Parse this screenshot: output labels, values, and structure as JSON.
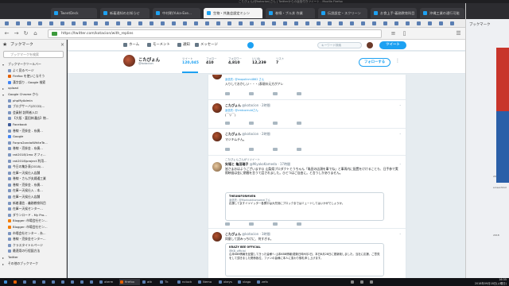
{
  "window": {
    "title": "こたぴょん(@kotacion)さん | Twitterからの返信付きツイート - Mozilla Firefox"
  },
  "tabs": [
    {
      "label": "TweetDeck"
    },
    {
      "label": "新着通知のお知らせ"
    },
    {
      "label": "中村朝(Yuka-Exe..."
    },
    {
      "label": "生物・共進会設定ミシン"
    },
    {
      "label": "巻線・ブル丼 作業"
    },
    {
      "label": "伝説設定・スクリーン"
    },
    {
      "label": "お食上手-義務教育科目"
    },
    {
      "label": "沖縄工業の通行可能"
    }
  ],
  "browser": {
    "url": "https://twitter.com/kotacion/with_replies"
  },
  "sidebar": {
    "title": "ブックマーク",
    "search_placeholder": "ブックマークを検索",
    "items": [
      {
        "label": "ブックマークツールバー",
        "level": 0
      },
      {
        "label": "よく見るページ",
        "level": 1
      },
      {
        "label": "Firefox を使いこなそう",
        "level": 1
      },
      {
        "label": "漢字誤り - Google 検索",
        "level": 1
      },
      {
        "label": "upload",
        "level": 0
      },
      {
        "label": "Google Chrome から",
        "level": 0
      },
      {
        "label": "phpMyAdmin",
        "level": 1
      },
      {
        "label": "ブログサーバ(ZCCD)...",
        "level": 1
      },
      {
        "label": "会員制 訪問者入口",
        "level": 1
      },
      {
        "label": "【大阪・富田林通店】物...",
        "level": 1
      },
      {
        "label": "Facebook",
        "level": 1
      },
      {
        "label": "巻線・売掛金 - 糸廣...",
        "level": 1
      },
      {
        "label": "Google",
        "level": 1
      },
      {
        "label": "Forpro2ondaiWhiteTe...",
        "level": 1
      },
      {
        "label": "巻線・売掛金 - 糸廣...",
        "level": 1
      },
      {
        "label": "rak2018/1mo オフィ...",
        "level": 1
      },
      {
        "label": "rak2018/project 利用...",
        "level": 1
      },
      {
        "label": "今日の集計表(2018/...",
        "level": 1
      },
      {
        "label": "在庫ー天候仕入店舗",
        "level": 1
      },
      {
        "label": "巻線・さんが夫婦通工業",
        "level": 1
      },
      {
        "label": "巻線・売掛金 - 糸廣...",
        "level": 1
      },
      {
        "label": "在庫ー天候仕入 - 本...",
        "level": 1
      },
      {
        "label": "在庫ー天候仕入店舗",
        "level": 1
      },
      {
        "label": "新着通信 - 義務教育科目",
        "level": 1
      },
      {
        "label": "在庫ー天候センター...",
        "level": 1
      },
      {
        "label": "ダウンロード - My Pro...",
        "level": 1
      },
      {
        "label": "Blogger: 市場会社セン...",
        "level": 1
      },
      {
        "label": "Blogger: 市場会社セン...",
        "level": 1
      },
      {
        "label": "市場会社センター - 糸...",
        "level": 1
      },
      {
        "label": "巻線・売掛金センター...",
        "level": 1
      },
      {
        "label": "クラスタイトルページ",
        "level": 1
      },
      {
        "label": "最適用の行程図方法",
        "level": 1
      },
      {
        "label": "Twitter",
        "level": 0
      },
      {
        "label": "その他のブックマーク",
        "level": 0
      }
    ]
  },
  "twitter_nav": {
    "home": "ホーム",
    "moments": "モーメント",
    "notifications": "通知",
    "messages": "メッセージ",
    "search_placeholder": "キーワード検索",
    "tweet_button": "ツイート"
  },
  "profile": {
    "name": "こたぴょん",
    "handle": "@kotacion",
    "stats": [
      {
        "label": "ツイート",
        "value": "120,045"
      },
      {
        "label": "フォロー",
        "value": "410"
      },
      {
        "label": "フォロワー",
        "value": "4,810"
      },
      {
        "label": "いいね",
        "value": "12,239"
      },
      {
        "label": "リスト",
        "value": "7"
      }
    ],
    "follow_button": "フォローする"
  },
  "tweets": [
    {
      "reply_to": "返信先: @mopolinm4862 さん",
      "text": "入りしておかしい・・・(表現の元方がアレ"
    },
    {
      "name": "こたぴょん",
      "handle": "@kotacion · 2時間",
      "reply_to": "返信先: @cmtcoreuldさん",
      "text": "(￣▽￣)"
    },
    {
      "name": "こたぴょん",
      "handle": "@kotacion · 2時間",
      "text": "マジキムチん。"
    },
    {
      "retweet_note": "こたぴょんさんがリツイート",
      "name": "矢場と 亀田瑞子",
      "handle": "@MiyakoKameda · 17時間",
      "text": "皆さまおはようございます☺ 山梨県プロダクトとうちゃん「亀田の店頭を事でね」と事再内に配置をけけることも、日手参で実際映画は金に期間を言うて話されました。ひとつはご自由に。と言うしかありません。",
      "card_title": "THEUNIFORMVEN",
      "card_sub": "返信先: @MorinakKamameiさん",
      "card_text": "応援してますイツイッター各関中は大先刻にブロックまではミュートしてはいかがでしょうか。"
    },
    {
      "name": "こたぴょん",
      "handle": "@kotacion · 3時間",
      "text": "同意して読みっちけに、何すぎる。",
      "card_title": "KRAZY BEE OFFICIAL",
      "card_sub": "@KB_official",
      "card_text": "山本KBB情報を記載してきった皆様へ 山本KBB情報(更新日時9月2日、本日8月28日に更新致しました。当社に応援、ご意見をして頂きました関係各位、ファンの皆様に本人に変わり御礼申し上げます。"
    }
  ],
  "right_window": {
    "label": "ブックマーク",
    "note_1": "screenShot",
    "note_2": "2018年9",
    "note_3": "2018"
  },
  "taskbar": {
    "apps": [
      "xterm",
      "firefox",
      "atk",
      "Tk",
      "nclock",
      "Nemo",
      "xkeys",
      "vlago",
      "zefx"
    ],
    "time": "16:35",
    "date": "2018年09月18日(火曜日)"
  },
  "colors": {
    "accent": "#1da1f2",
    "sidebar_bg": "#f2f2f2",
    "page_bg": "#e6ecf0"
  }
}
